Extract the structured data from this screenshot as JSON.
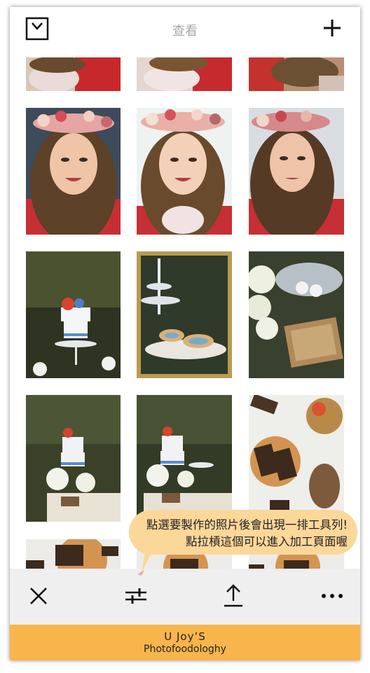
{
  "header": {
    "title": "查看",
    "left_icon": "album-icon",
    "right_icon": "plus-icon"
  },
  "photos": [
    {
      "name": "photo-r0c0",
      "desc": "partial top row portrait"
    },
    {
      "name": "photo-r0c1",
      "desc": "partial top row portrait"
    },
    {
      "name": "photo-r0c2",
      "desc": "partial top row portrait"
    },
    {
      "name": "photo-r1c0",
      "desc": "selfie with flower crown"
    },
    {
      "name": "photo-r1c1",
      "desc": "selfie with flower crown"
    },
    {
      "name": "photo-r1c2",
      "desc": "selfie with flower crown"
    },
    {
      "name": "photo-r2c0",
      "desc": "cake in forest"
    },
    {
      "name": "photo-r2c1",
      "desc": "cookie tiered stand"
    },
    {
      "name": "photo-r2c2",
      "desc": "cupcake stand and box"
    },
    {
      "name": "photo-r3c0",
      "desc": "cake table forest"
    },
    {
      "name": "photo-r3c1",
      "desc": "cake table forest"
    },
    {
      "name": "photo-r3c2",
      "desc": "chocolate and pinecone"
    },
    {
      "name": "photo-r4c0",
      "desc": "partial bottom row"
    },
    {
      "name": "photo-r4c1",
      "desc": "partial bottom row"
    },
    {
      "name": "photo-r4c2",
      "desc": "partial bottom row"
    }
  ],
  "tooltip": {
    "line1": "點選要製作的照片後會出現一排工具列!",
    "line2": "點拉槓這個可以進入加工頁面喔"
  },
  "toolbar": {
    "close_icon": "close-icon",
    "adjust_icon": "adjust-sliders-icon",
    "share_icon": "share-upload-icon",
    "more_icon": "more-dots-icon"
  },
  "brand": {
    "line1": "U Joy’S",
    "line2": "Photofoodologhy"
  },
  "colors": {
    "brand_bar": "#f7b54b",
    "tooltip_bg": "#fcd79a",
    "toolbar_bg": "#efefef"
  }
}
